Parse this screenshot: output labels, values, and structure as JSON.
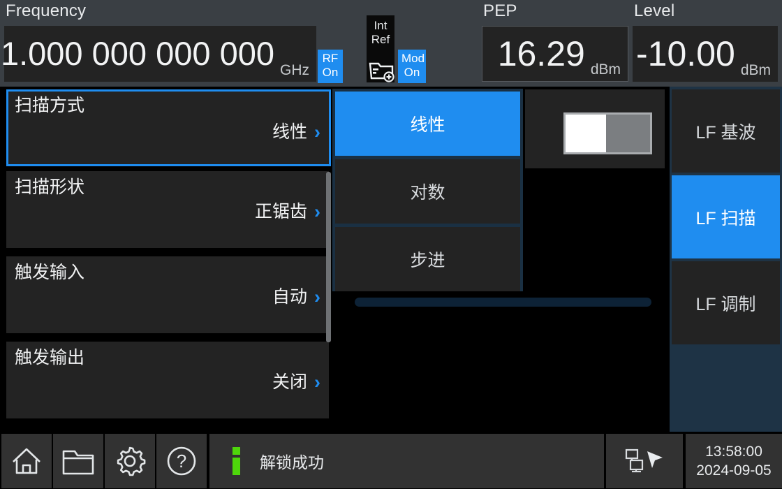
{
  "header": {
    "frequency": {
      "label": "Frequency",
      "value": "1.000 000 000 000",
      "unit": "GHz"
    },
    "rf_badge": {
      "line1": "RF",
      "line2": "On"
    },
    "mod_badge": {
      "line1": "Mod",
      "line2": "On"
    },
    "reference": {
      "line1": "Int",
      "line2": "Ref",
      "icon": "folder-add-icon"
    },
    "pep": {
      "label": "PEP",
      "value": "16.29",
      "unit": "dBm"
    },
    "level": {
      "label": "Level",
      "value": "-10.00",
      "unit": "dBm"
    }
  },
  "menu": {
    "items": [
      {
        "title": "扫描方式",
        "value": "线性",
        "selected": true
      },
      {
        "title": "扫描形状",
        "value": "正锯齿",
        "selected": false
      },
      {
        "title": "触发输入",
        "value": "自动",
        "selected": false
      },
      {
        "title": "触发输出",
        "value": "关闭",
        "selected": false
      }
    ]
  },
  "dropdown": {
    "options": [
      {
        "label": "线性",
        "selected": true
      },
      {
        "label": "对数",
        "selected": false
      },
      {
        "label": "步进",
        "selected": false
      }
    ]
  },
  "toggle": {
    "state": "off"
  },
  "sidebar": {
    "items": [
      {
        "label": "LF 基波",
        "selected": false
      },
      {
        "label": "LF 扫描",
        "selected": true
      },
      {
        "label": "LF 调制",
        "selected": false
      }
    ]
  },
  "footer": {
    "buttons": [
      {
        "name": "home-icon"
      },
      {
        "name": "folder-icon"
      },
      {
        "name": "gear-icon"
      },
      {
        "name": "help-icon"
      }
    ],
    "status_message": "解锁成功",
    "network_icon": "network-remote-icon",
    "time": "13:58:00",
    "date": "2024-09-05"
  },
  "colors": {
    "accent": "#1f8df0",
    "panel": "#232323",
    "header_bg": "#3a3f44",
    "sidebar_bg": "#1e3345",
    "info_green": "#4ed60b"
  }
}
